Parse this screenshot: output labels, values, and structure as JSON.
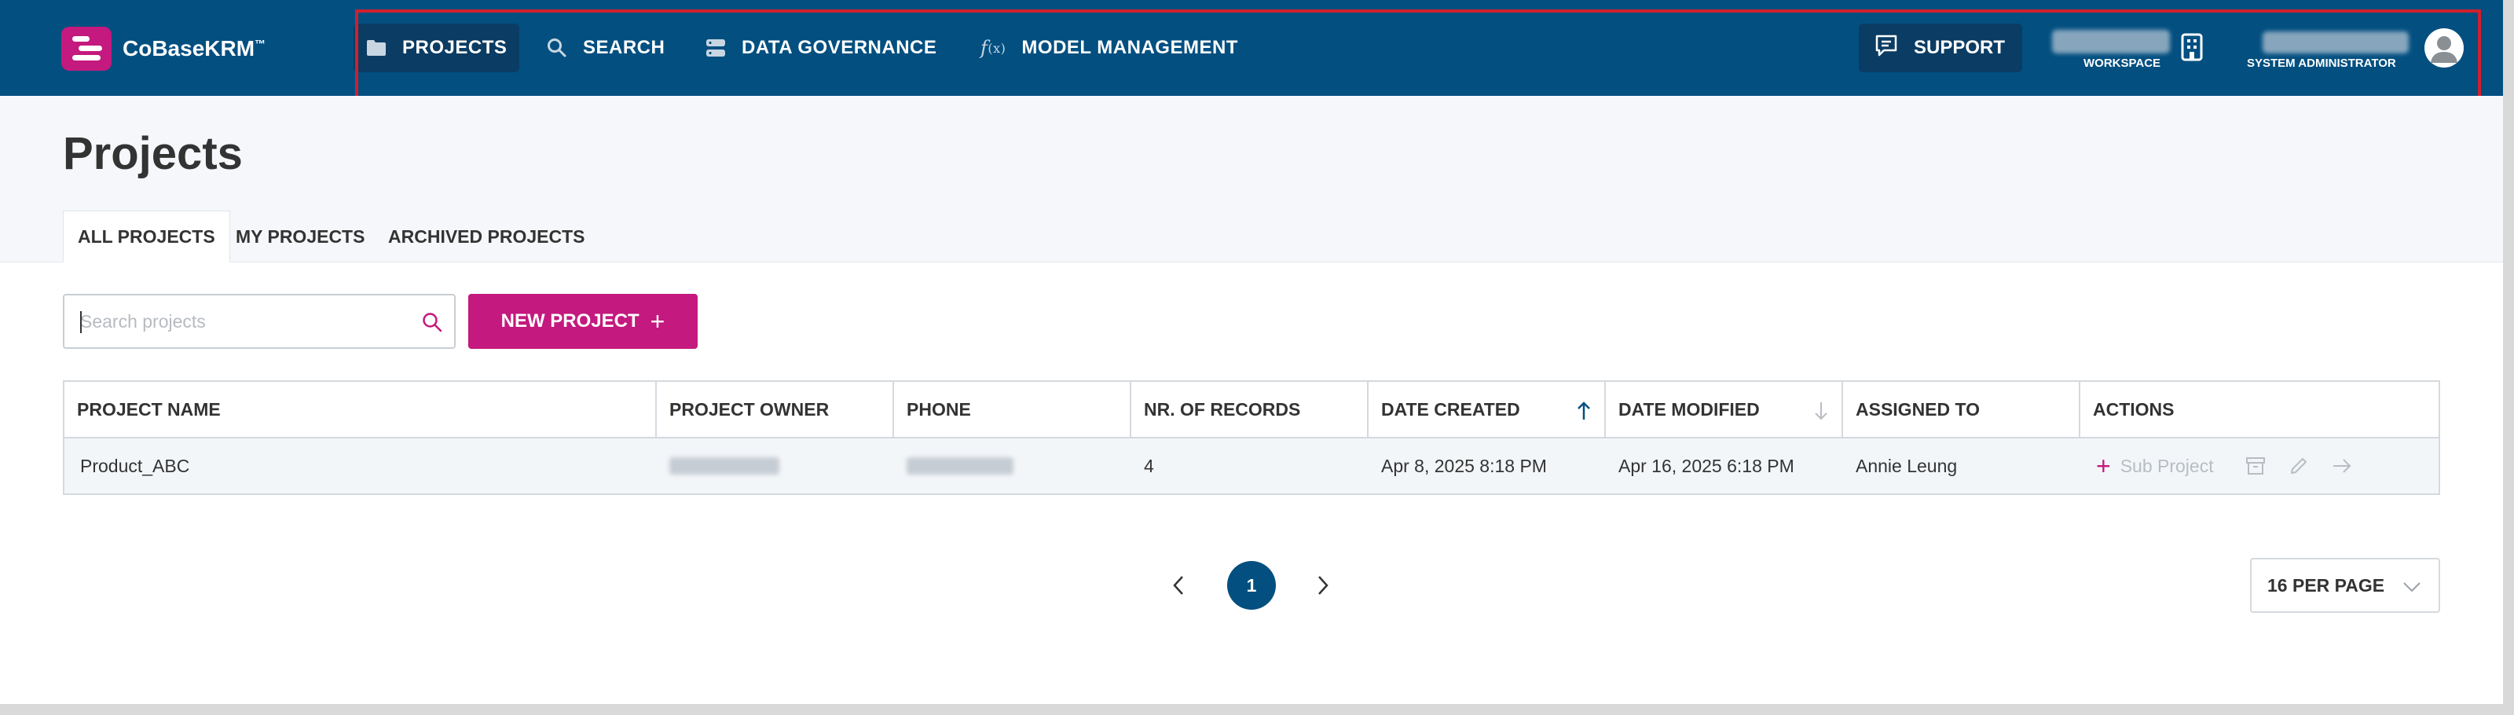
{
  "brand": {
    "name": "CoBaseKRM",
    "trademark": "™"
  },
  "nav": {
    "items": [
      {
        "label": "PROJECTS",
        "icon": "folder-icon",
        "active": true
      },
      {
        "label": "SEARCH",
        "icon": "search-icon",
        "active": false
      },
      {
        "label": "DATA GOVERNANCE",
        "icon": "database-icon",
        "active": false
      },
      {
        "label": "MODEL MANAGEMENT",
        "icon": "function-icon",
        "active": false
      }
    ],
    "support_label": "SUPPORT",
    "workspace_label": "WORKSPACE",
    "user_role": "SYSTEM ADMINISTRATOR"
  },
  "page": {
    "title": "Projects",
    "tabs": [
      "ALL PROJECTS",
      "MY PROJECTS",
      "ARCHIVED PROJECTS"
    ],
    "active_tab": "ALL PROJECTS"
  },
  "toolbar": {
    "search_placeholder": "Search projects",
    "new_project_label": "NEW PROJECT",
    "new_project_icon": "+"
  },
  "table": {
    "columns": [
      "PROJECT NAME",
      "PROJECT OWNER",
      "PHONE",
      "NR. OF RECORDS",
      "DATE CREATED",
      "DATE MODIFIED",
      "ASSIGNED TO",
      "ACTIONS"
    ],
    "sort": {
      "date_created": "ascending",
      "date_modified": "descending"
    },
    "rows": [
      {
        "project_name": "Product_ABC",
        "nr_of_records": "4",
        "date_created": "Apr 8, 2025 8:18 PM",
        "date_modified": "Apr 16, 2025 6:18 PM",
        "assigned_to": "Annie Leung",
        "actions": {
          "add_icon": "+",
          "sub_project_label": "Sub Project"
        }
      }
    ]
  },
  "pagination": {
    "current_page": "1",
    "per_page_label": "16 PER PAGE"
  },
  "colors": {
    "nav_bg": "#024f80",
    "accent": "#c4197e",
    "highlight": "#d0202e"
  }
}
